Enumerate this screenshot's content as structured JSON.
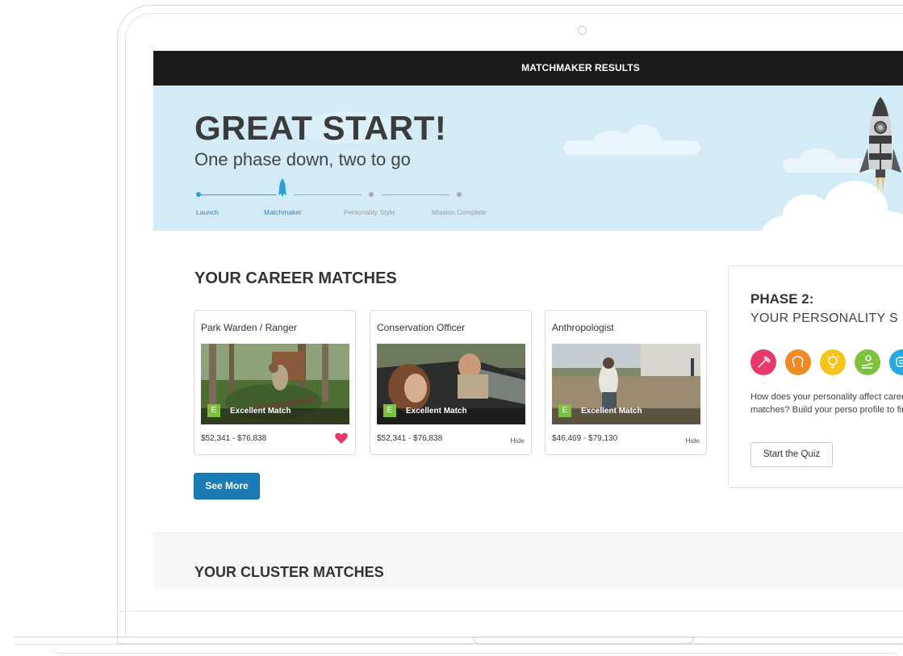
{
  "topbar": {
    "title": "MATCHMAKER RESULTS"
  },
  "hero": {
    "title": "GREAT START!",
    "subtitle": "One phase down, two to go",
    "steps": [
      "Launch",
      "Matchmaker",
      "Personality Style",
      "Mission Complete"
    ],
    "current_step": "Matchmaker"
  },
  "career_section": {
    "heading": "YOUR CAREER MATCHES",
    "cards": [
      {
        "title": "Park Warden / Ranger",
        "badge_letter": "E",
        "badge_text": "Excellent Match",
        "salary": "$52,341 - $76,838",
        "action": "heart"
      },
      {
        "title": "Conservation Officer",
        "badge_letter": "E",
        "badge_text": "Excellent Match",
        "salary": "$52,341 - $76,838",
        "action_label": "Hide"
      },
      {
        "title": "Anthropologist",
        "badge_letter": "E",
        "badge_text": "Excellent Match",
        "salary": "$46,469 - $79,130",
        "action_label": "Hide"
      }
    ],
    "see_more_label": "See More"
  },
  "phase_panel": {
    "heading": "PHASE 2:",
    "subheading": "YOUR PERSONALITY S",
    "icons": [
      {
        "name": "hammer-icon",
        "color": "#e8396a"
      },
      {
        "name": "head-icon",
        "color": "#f08a24"
      },
      {
        "name": "lightbulb-icon",
        "color": "#f7c21b"
      },
      {
        "name": "helping-hand-icon",
        "color": "#7cc240"
      },
      {
        "name": "chat-icon",
        "color": "#27a9e1"
      }
    ],
    "description": "How does your personality affect career matches? Build your perso profile to find out.",
    "button_label": "Start the Quiz"
  },
  "cluster_section": {
    "heading": "YOUR CLUSTER MATCHES"
  },
  "colors": {
    "accent_blue": "#1b7bb5",
    "match_green": "#7cc240",
    "heart_pink": "#e8396a",
    "hero_bg": "#d3ebf6"
  }
}
